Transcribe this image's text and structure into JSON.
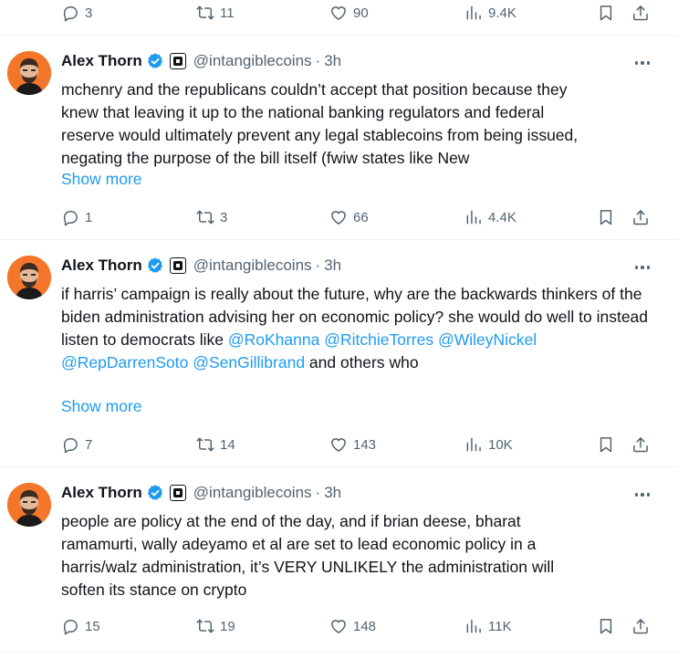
{
  "colors": {
    "text": "#0f1419",
    "muted": "#536471",
    "link": "#1d9bf0",
    "avatar_bg": "#f4762a",
    "verified": "#1d9bf0"
  },
  "top_actions": {
    "replies": "3",
    "retweets": "11",
    "likes": "90",
    "views": "9.4K"
  },
  "tweets": [
    {
      "name": "Alex Thorn",
      "handle": "@intangiblecoins",
      "dot": "·",
      "time": "3h",
      "text_lines": [
        "mchenry and the republicans couldn’t accept that position because they",
        "knew that leaving it up to the national banking regulators and federal",
        "reserve would ultimately prevent any legal stablecoins from being issued,",
        "negating the purpose of the bill itself (fwiw states like New"
      ],
      "show_more": "Show more",
      "replies": "1",
      "retweets": "3",
      "likes": "66",
      "views": "4.4K"
    },
    {
      "name": "Alex Thorn",
      "handle": "@intangiblecoins",
      "dot": "·",
      "time": "3h",
      "text_part1": "if harris’ campaign is really about the future, why are the backwards thinkers of the biden administration advising her on economic policy? she would do well to instead listen to democrats like ",
      "mentions": [
        "@RoKhanna",
        "@RitchieTorres",
        "@WileyNickel",
        "@RepDarrenSoto",
        "@SenGillibrand"
      ],
      "text_part2": " and others who",
      "show_more": "Show more",
      "replies": "7",
      "retweets": "14",
      "likes": "143",
      "views": "10K"
    },
    {
      "name": "Alex Thorn",
      "handle": "@intangiblecoins",
      "dot": "·",
      "time": "3h",
      "text_lines": [
        "people are policy at the end of the day, and if brian deese, bharat",
        "ramamurti, wally adeyamo et al are set to lead economic policy in a",
        "harris/walz administration, it’s VERY UNLIKELY the administration will",
        "soften its stance on crypto"
      ],
      "replies": "15",
      "retweets": "19",
      "likes": "148",
      "views": "11K"
    }
  ]
}
